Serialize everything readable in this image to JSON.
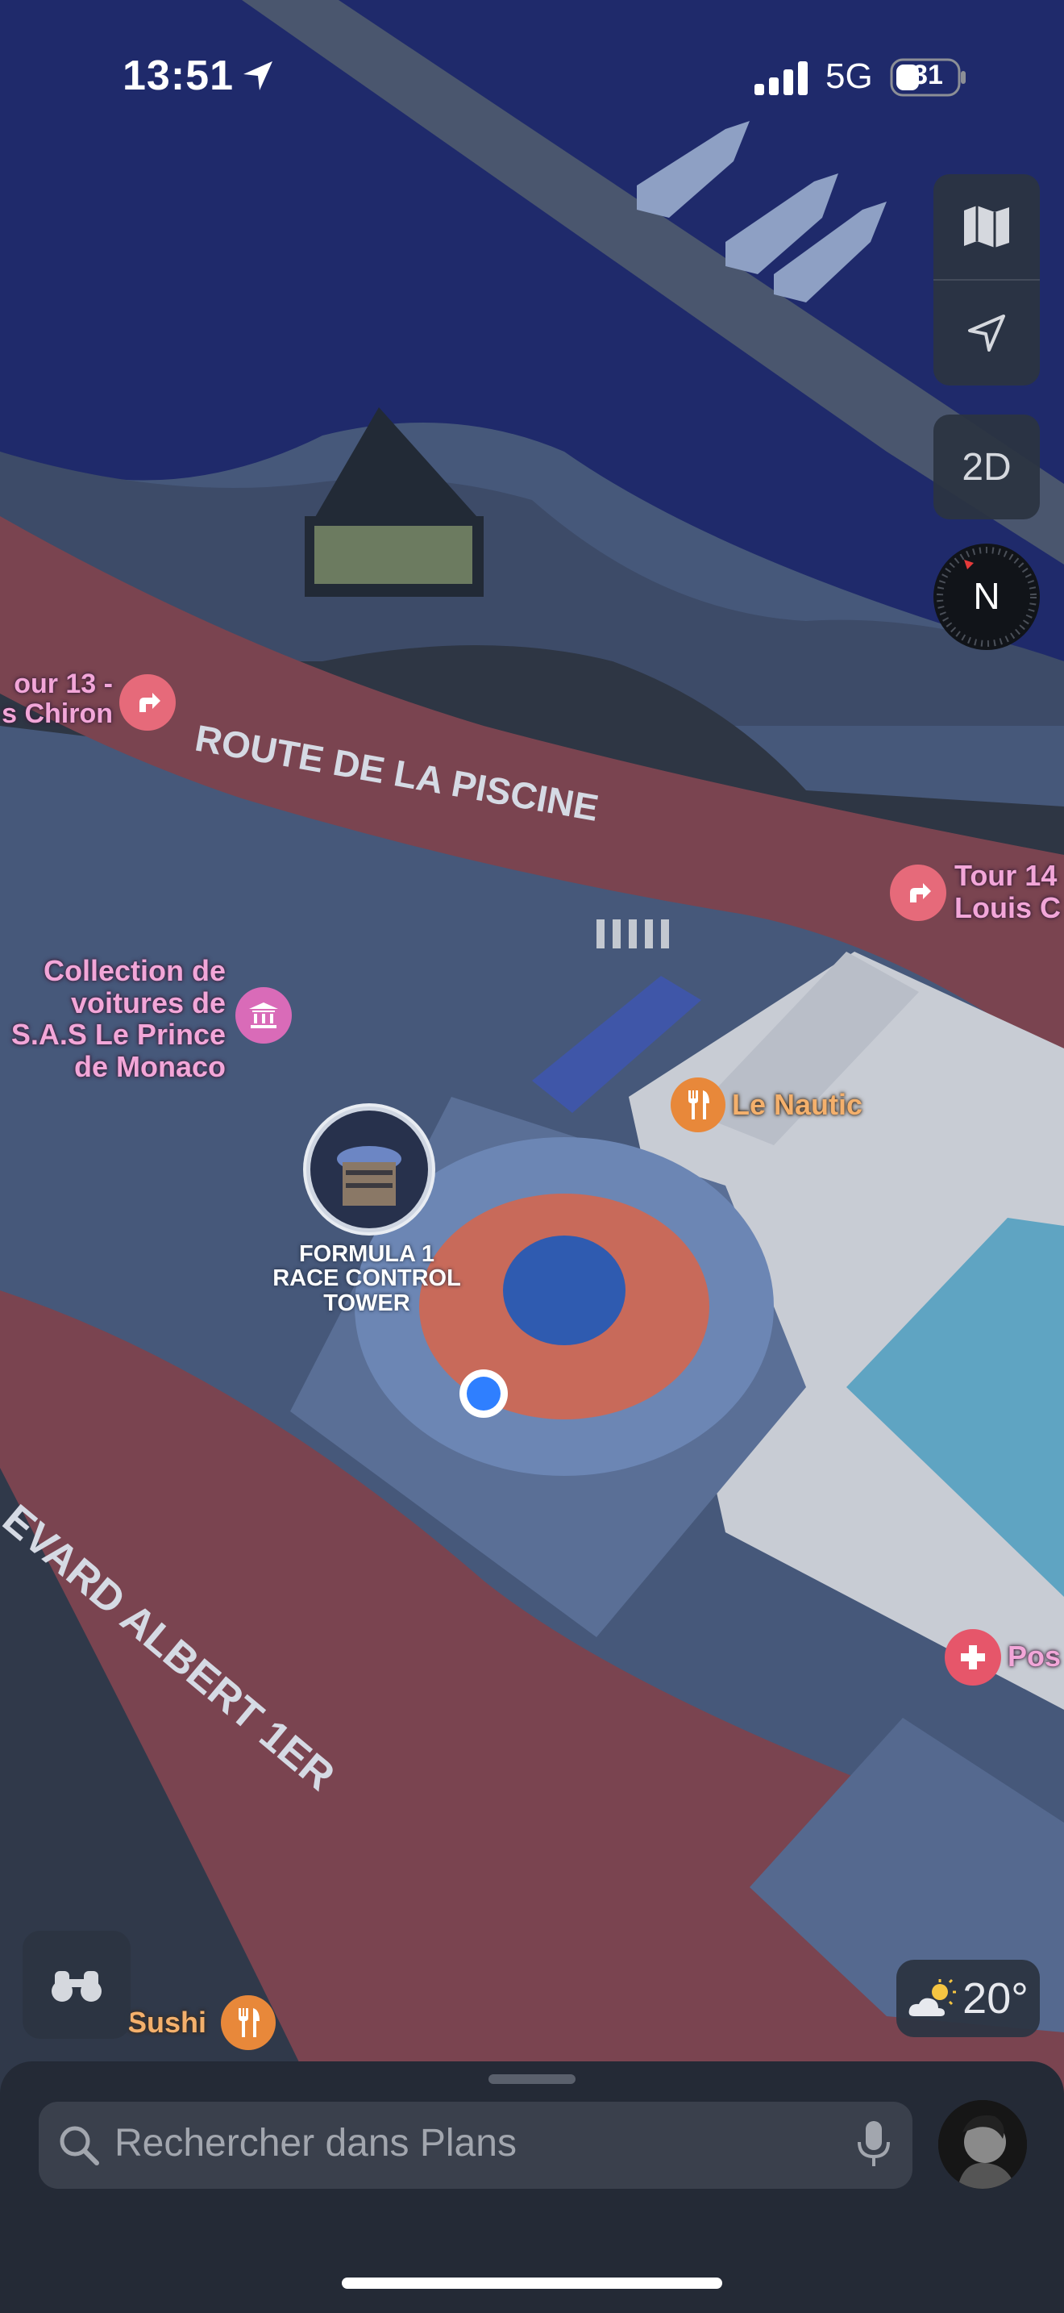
{
  "status_bar": {
    "time": "13:51",
    "network": "5G",
    "battery": "31"
  },
  "map": {
    "streets": {
      "route_piscine": "ROUTE DE LA PISCINE",
      "boulevard": "EVARD ALBERT 1ER"
    },
    "pois": {
      "tour13": {
        "line1": "our 13 -",
        "line2": "s Chiron"
      },
      "tour14": {
        "line1": "Tour 14",
        "line2": "Louis C"
      },
      "collection": {
        "line1": "Collection de",
        "line2": "voitures de",
        "line3": "S.A.S Le Prince",
        "line4": "de Monaco"
      },
      "le_nautic": "Le Nautic",
      "f1_tower": {
        "line1": "FORMULA 1",
        "line2": "RACE CONTROL",
        "line3": "TOWER"
      },
      "post": "Pos",
      "sushi": "Sushi"
    }
  },
  "controls": {
    "view_mode": "2D",
    "compass_label": "N",
    "weather_temp": "20°"
  },
  "search": {
    "placeholder": "Rechercher dans Plans"
  },
  "icons": {
    "map_mode": "map-icon",
    "location": "location-arrow-icon",
    "compass": "compass-icon",
    "binoculars": "binoculars-icon",
    "weather": "partly-sunny-icon",
    "search": "search-icon",
    "mic": "microphone-icon",
    "restaurant": "fork-knife-icon",
    "museum": "museum-icon",
    "pharmacy": "cross-icon",
    "direction": "turn-right-icon"
  },
  "colors": {
    "water": "#1f2a6b",
    "road": "#7a4450",
    "ground": "#46587a",
    "pool": "#5fa4c2"
  }
}
